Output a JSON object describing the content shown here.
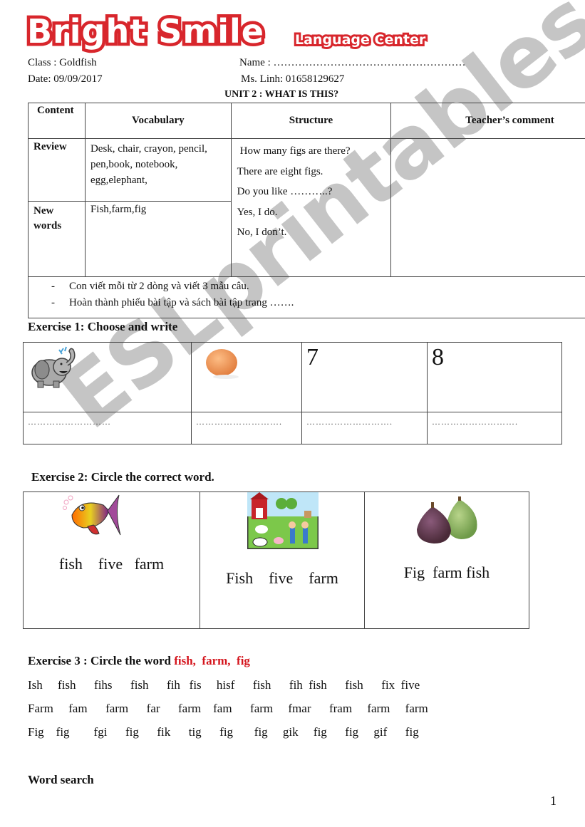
{
  "logo": {
    "main": "Bright Smile",
    "sub": "Language Center",
    "brand_color": "#d8262c"
  },
  "header": {
    "class_label": "Class : Goldfish",
    "name_label": "Name : ………………………………………………",
    "date_label": "Date: 09/09/2017",
    "teacher_label": "Ms. Linh: 01658129627",
    "unit_title": "UNIT 2 : WHAT IS THIS?"
  },
  "plan_table": {
    "headers": {
      "content": "Content",
      "vocabulary": "Vocabulary",
      "structure": "Structure",
      "teacher_comment": "Teacher’s comment"
    },
    "review_label": "Review",
    "review_vocab": [
      "Desk, chair, crayon, pencil,",
      "pen,book, notebook,",
      "egg,elephant,"
    ],
    "new_words_label": [
      "New",
      "words"
    ],
    "new_words_vocab": "Fish,farm,fig",
    "structure_lines": [
      "How many figs are there?",
      "There are eight  figs.",
      "Do you like ………..?",
      "Yes, I do.",
      "No, I don’t."
    ],
    "homework": [
      "Con viết mỗi từ 2 dòng và viết 3 mẫu câu.",
      "Hoàn thành phiếu bài tập và  sách bài tập trang ……."
    ],
    "bullet": "-"
  },
  "exercise1": {
    "title": "Exercise 1: Choose and write",
    "cells": [
      {
        "picture": "elephant-icon",
        "number": ""
      },
      {
        "picture": "egg-icon",
        "number": ""
      },
      {
        "picture": "",
        "number": "7"
      },
      {
        "picture": "",
        "number": "8"
      }
    ],
    "answer_lines": [
      "………………………",
      "……………………….",
      "……………………….",
      "………………………."
    ]
  },
  "exercise2": {
    "title": "Exercise 2: Circle the correct word.",
    "cells": [
      {
        "picture": "fish-icon",
        "options": "fish    five   farm"
      },
      {
        "picture": "farm-icon",
        "options": "Fish    five    farm"
      },
      {
        "picture": "figs-icon",
        "options": "Fig  farm fish"
      }
    ]
  },
  "exercise3": {
    "title": "Exercise 3 :  Circle the word ",
    "target_words": "fish,  farm,  fig",
    "target_color": "#d4141c",
    "rows": [
      "Ish     fish      fihs      fish      fih   fis     hisf      fish      fih  fish      fish      fix  five",
      "Farm     fam      farm      far      farm    fam      farm     fmar      fram     farm     farm",
      "Fig    fig        fgi      fig      fik      tig      fig       fig     gik     fig      fig     gif      fig"
    ]
  },
  "word_search": {
    "title": "Word search"
  },
  "page_number": "1",
  "watermark": "ESLprintables.com"
}
